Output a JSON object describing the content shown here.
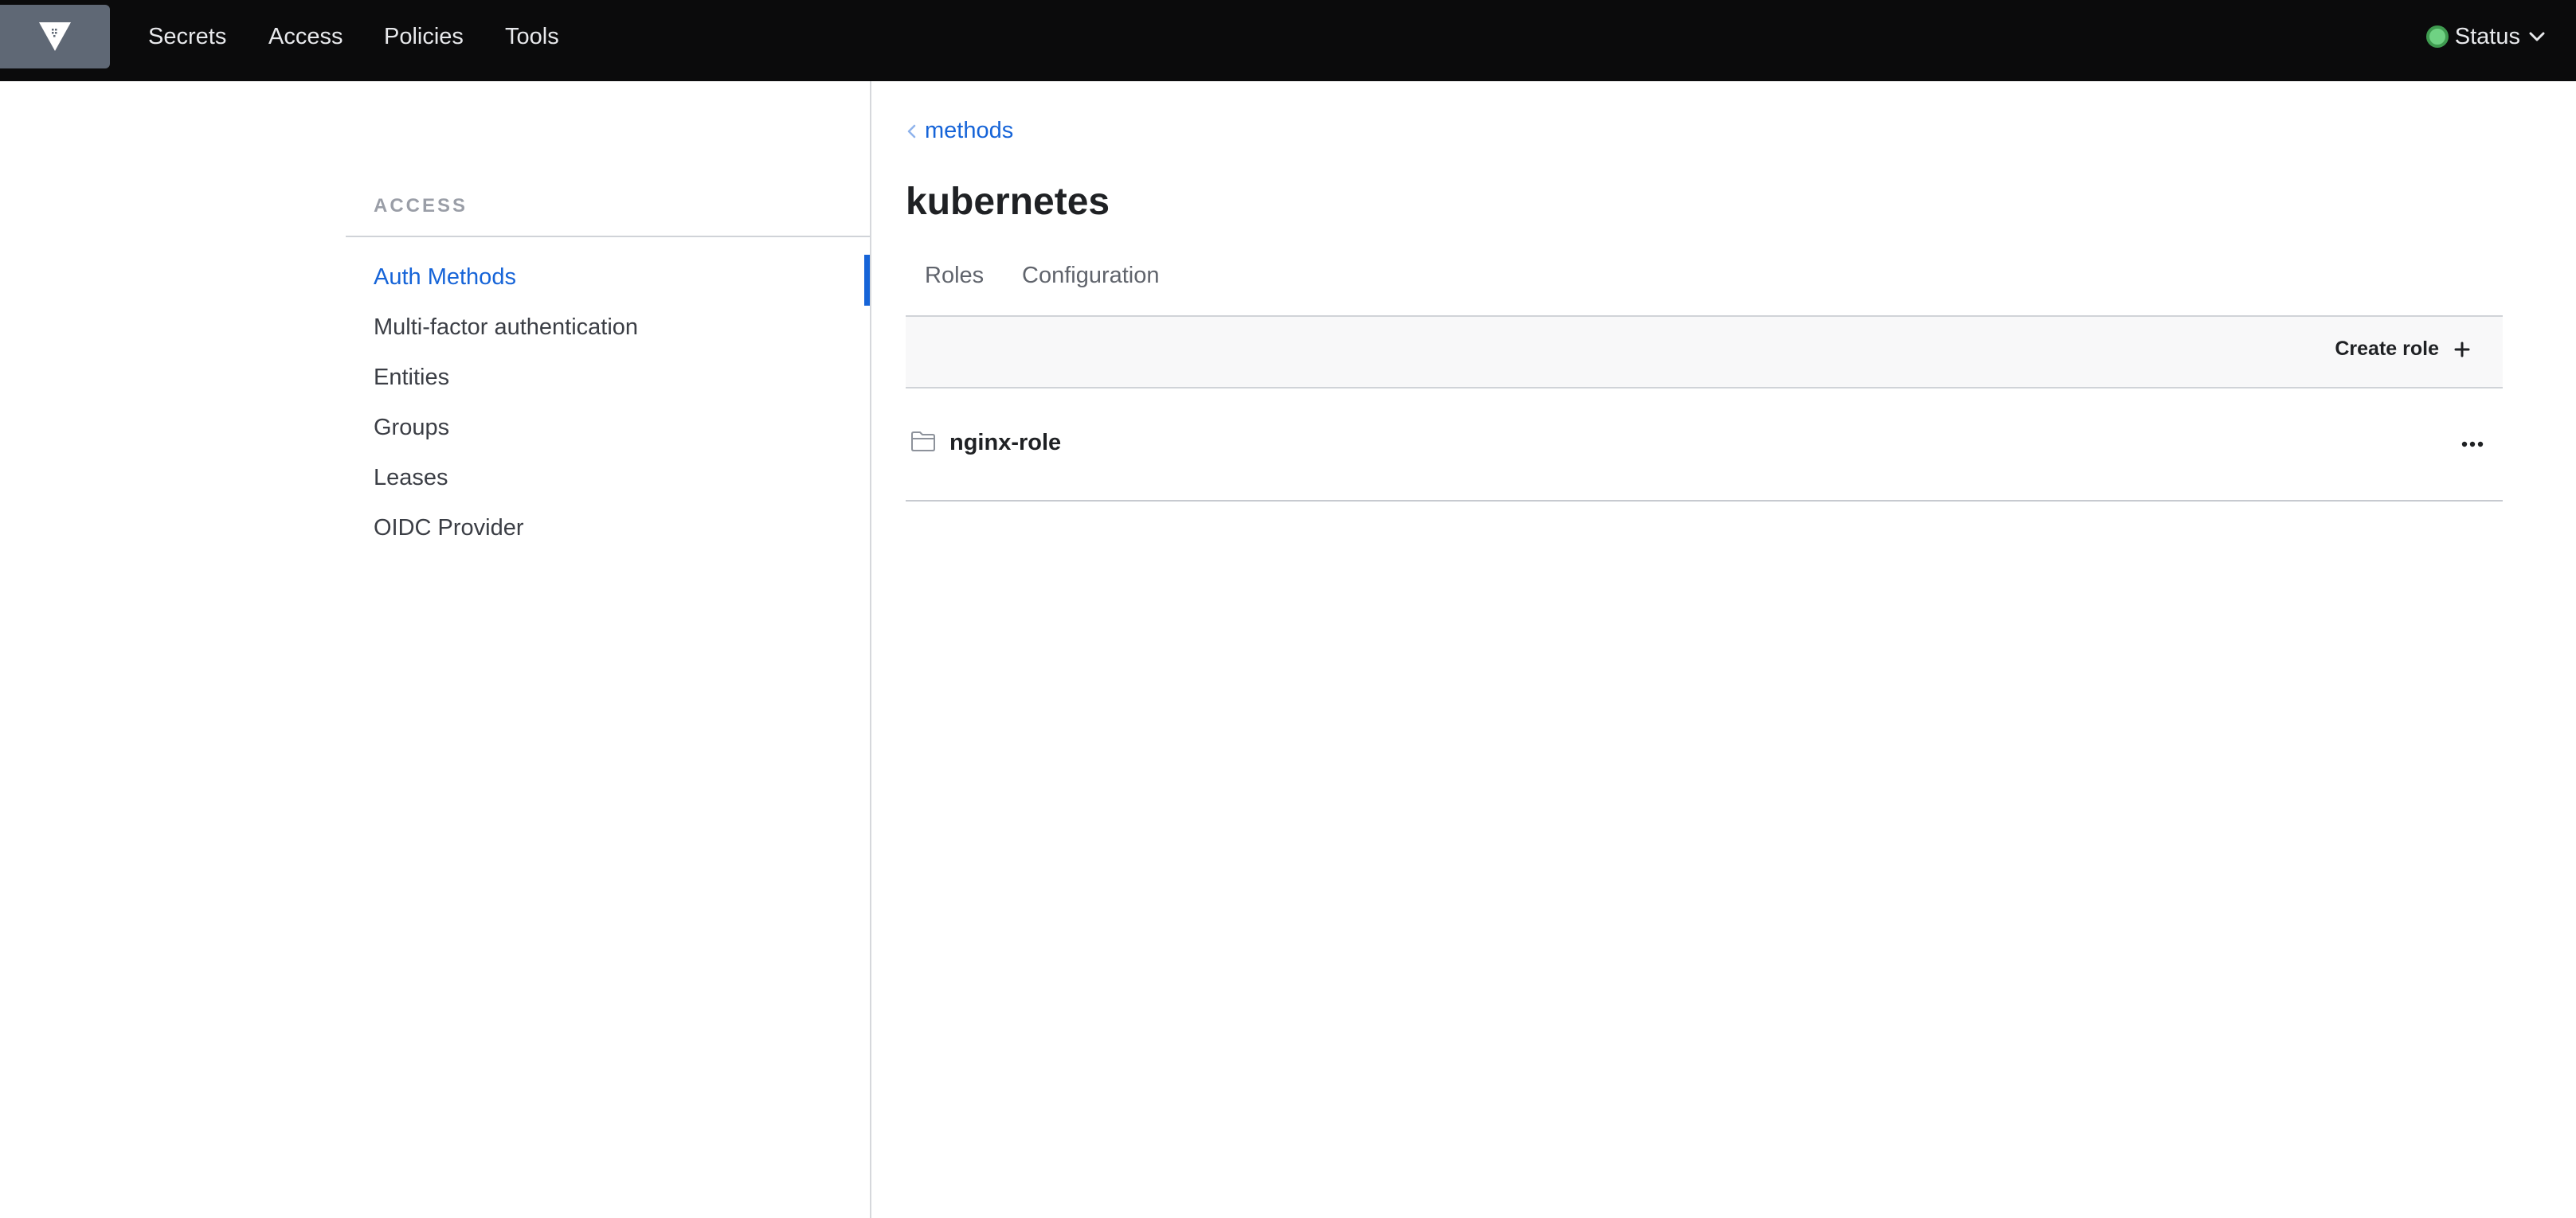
{
  "nav": {
    "items": [
      {
        "label": "Secrets"
      },
      {
        "label": "Access"
      },
      {
        "label": "Policies"
      },
      {
        "label": "Tools"
      }
    ],
    "status_label": "Status"
  },
  "sidebar": {
    "heading": "ACCESS",
    "items": [
      {
        "label": "Auth Methods",
        "active": true
      },
      {
        "label": "Multi-factor authentication"
      },
      {
        "label": "Entities"
      },
      {
        "label": "Groups"
      },
      {
        "label": "Leases"
      },
      {
        "label": "OIDC Provider"
      }
    ]
  },
  "main": {
    "breadcrumb": "methods",
    "title": "kubernetes",
    "tabs": [
      {
        "label": "Roles"
      },
      {
        "label": "Configuration"
      }
    ],
    "create_label": "Create role",
    "rows": [
      {
        "label": "nginx-role"
      }
    ]
  },
  "colors": {
    "accent": "#1664d8",
    "nav_bg": "#0b0b0c",
    "status_ok": "#6fd283"
  },
  "icons": {
    "logo": "vault-logo-icon",
    "status": "status-dot-icon",
    "chevron": "chevron-down-icon",
    "back": "chevron-left-icon",
    "plus": "plus-icon",
    "folder": "folder-icon",
    "more": "more-horizontal-icon"
  }
}
